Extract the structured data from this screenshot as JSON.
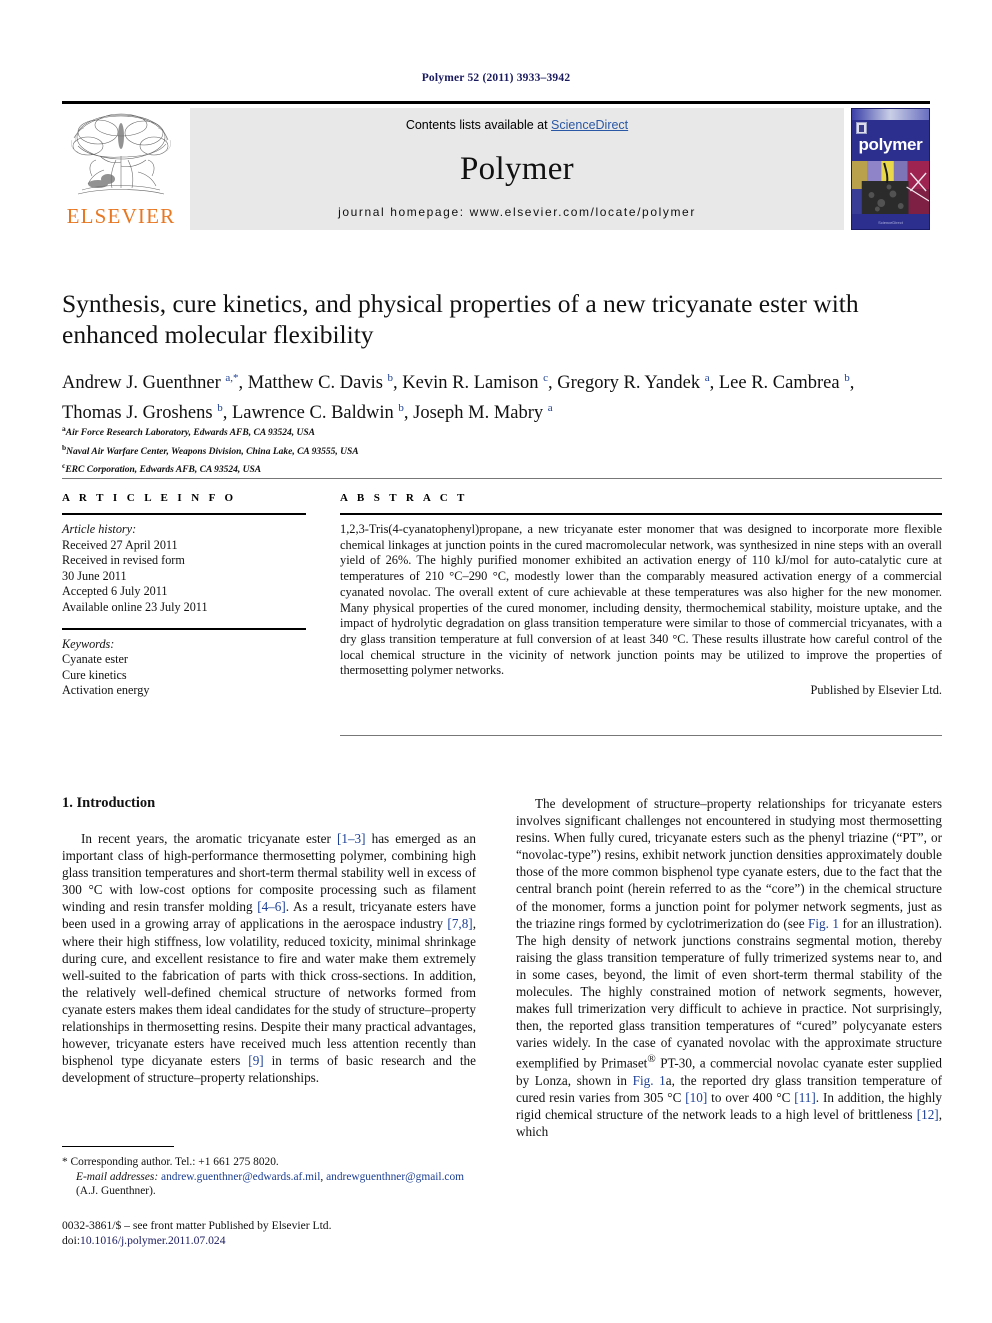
{
  "running_head": "Polymer 52 (2011) 3933–3942",
  "masthead": {
    "contents_prefix": "Contents lists available at ",
    "sciencedirect": "ScienceDirect",
    "journal_name": "Polymer",
    "homepage": "journal homepage: www.elsevier.com/locate/polymer",
    "publisher_logo_text": "ELSEVIER",
    "cover_word": "polymer",
    "cover_credit": "ScienceDirect",
    "accent_orange": "#E87722",
    "accent_link_blue": "#2a57a5",
    "cover_blue": "#2d2f8f"
  },
  "article": {
    "title": "Synthesis, cure kinetics, and physical properties of a new tricyanate ester with enhanced molecular flexibility",
    "authors_line1_html": "Andrew J. Guenthner <sup>a,*</sup>, Matthew C. Davis <sup>b</sup>, Kevin R. Lamison <sup>c</sup>, Gregory R. Yandek <sup>a</sup>, Lee R. Cambrea <sup>b</sup>,",
    "authors_line2_html": "Thomas J. Groshens <sup>b</sup>, Lawrence C. Baldwin <sup>b</sup>, Joseph M. Mabry <sup>a</sup>",
    "affiliations": [
      {
        "marker": "a",
        "text": "Air Force Research Laboratory, Edwards AFB, CA 93524, USA"
      },
      {
        "marker": "b",
        "text": "Naval Air Warfare Center, Weapons Division, China Lake, CA 93555, USA"
      },
      {
        "marker": "c",
        "text": "ERC Corporation, Edwards AFB, CA 93524, USA"
      }
    ]
  },
  "article_info": {
    "heading": "A R T I C L E   I N F O",
    "history_label": "Article history:",
    "history": [
      "Received 27 April 2011",
      "Received in revised form",
      "30 June 2011",
      "Accepted 6 July 2011",
      "Available online 23 July 2011"
    ],
    "keywords_label": "Keywords:",
    "keywords": [
      "Cyanate ester",
      "Cure kinetics",
      "Activation energy"
    ]
  },
  "abstract": {
    "heading": "A B S T R A C T",
    "text": "1,2,3-Tris(4-cyanatophenyl)propane, a new tricyanate ester monomer that was designed to incorporate more flexible chemical linkages at junction points in the cured macromolecular network, was synthesized in nine steps with an overall yield of 26%. The highly purified monomer exhibited an activation energy of 110 kJ/mol for auto-catalytic cure at temperatures of 210 °C–290 °C, modestly lower than the comparably measured activation energy of a commercial cyanated novolac. The overall extent of cure achievable at these temperatures was also higher for the new monomer. Many physical properties of the cured monomer, including density, thermochemical stability, moisture uptake, and the impact of hydrolytic degradation on glass transition temperature were similar to those of commercial tricyanates, with a dry glass transition temperature at full conversion of at least 340 °C. These results illustrate how careful control of the local chemical structure in the vicinity of network junction points may be utilized to improve the properties of thermosetting polymer networks.",
    "publisher_line": "Published by Elsevier Ltd."
  },
  "body": {
    "section_number_title": "1. Introduction",
    "left_paragraph_html": "In recent years, the aromatic tricyanate ester <span class=\"ref\">[1–3]</span> has emerged as an important class of high-performance thermosetting polymer, combining high glass transition temperatures and short-term thermal stability well in excess of 300 °C with low-cost options for composite processing such as filament winding and resin transfer molding <span class=\"ref\">[4–6]</span>. As a result, tricyanate esters have been used in a growing array of applications in the aerospace industry <span class=\"ref\">[7,8]</span>, where their high stiffness, low volatility, reduced toxicity, minimal shrinkage during cure, and excellent resistance to fire and water make them extremely well-suited to the fabrication of parts with thick cross-sections. In addition, the relatively well-defined chemical structure of networks formed from cyanate esters makes them ideal candidates for the study of structure–property relationships in thermosetting resins. Despite their many practical advantages, however, tricyanate esters have received much less attention recently than bisphenol type dicyanate esters <span class=\"ref\">[9]</span> in terms of basic research and the development of structure–property relationships.",
    "right_paragraph_html": "The development of structure–property relationships for tricyanate esters involves significant challenges not encountered in studying most thermosetting resins. When fully cured, tricyanate esters such as the phenyl triazine (“PT”, or “novolac-type”) resins, exhibit network junction densities approximately double those of the more common bisphenol type cyanate esters, due to the fact that the central branch point (herein referred to as the “core”) in the chemical structure of the monomer, forms a junction point for polymer network segments, just as the triazine rings formed by cyclotrimerization do (see <span class=\"ref\">Fig. 1</span> for an illustration). The high density of network junctions constrains segmental motion, thereby raising the glass transition temperature of fully trimerized systems near to, and in some cases, beyond, the limit of even short-term thermal stability of the molecules. The highly constrained motion of network segments, however, makes full trimerization very difficult to achieve in practice. Not surprisingly, then, the reported glass transition temperatures of “cured” polycyanate esters varies widely. In the case of cyanated novolac with the approximate structure exemplified by Primaset<sup>®</sup> PT-30, a commercial novolac cyanate ester supplied by Lonza, shown in <span class=\"ref\">Fig. 1</span>a, the reported dry glass transition temperature of cured resin varies from 305 °C <span class=\"ref\">[10]</span> to over 400 °C <span class=\"ref\">[11]</span>. In addition, the highly rigid chemical structure of the network leads to a high level of brittleness <span class=\"ref\">[12]</span>, which"
  },
  "footnotes": {
    "corresponding_html": "* Corresponding author. Tel.: +1 661 275 8020.",
    "email_html": "<span class=\"em\">E-mail addresses:</span> <span class=\"mail\">andrew.guenthner@edwards.af.mil</span>, <span class=\"mail\">andrewguenthner@gmail.com</span> (A.J. Guenthner).",
    "frontmatter_html": "0032-3861/$ – see front matter Published by Elsevier Ltd.",
    "doi_label": "doi:",
    "doi_value": "10.1016/j.polymer.2011.07.024"
  }
}
